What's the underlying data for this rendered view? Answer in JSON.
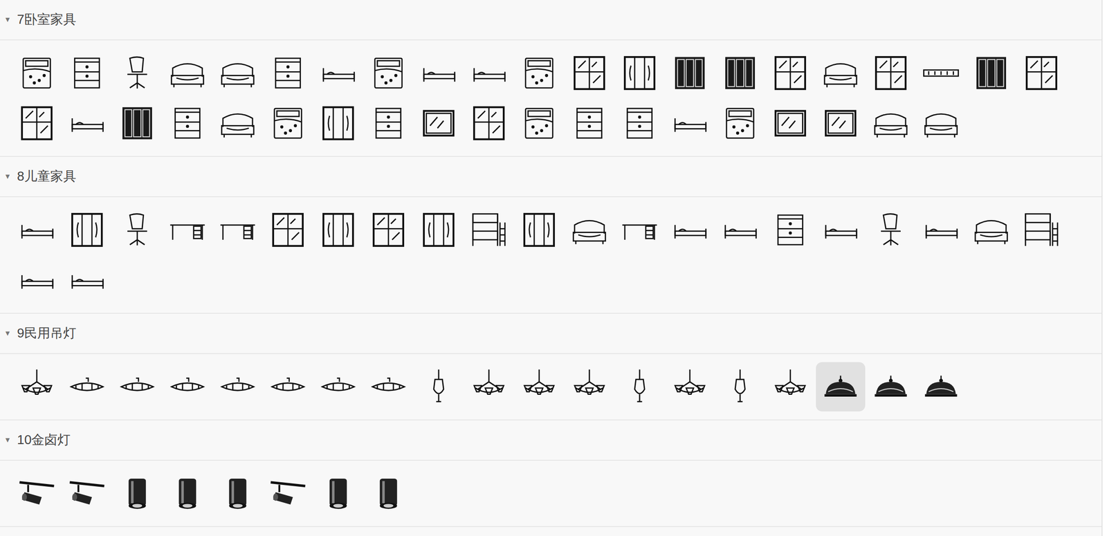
{
  "sections": [
    {
      "title": "7卧室家具",
      "toggle": "▼",
      "expanded": true,
      "items": [
        {
          "kind": "bed-plan",
          "selected": false
        },
        {
          "kind": "cabinet",
          "selected": false
        },
        {
          "kind": "chair",
          "selected": false
        },
        {
          "kind": "bed-front",
          "selected": false
        },
        {
          "kind": "bed-front",
          "selected": false
        },
        {
          "kind": "cabinet",
          "selected": false
        },
        {
          "kind": "bed-side",
          "selected": false
        },
        {
          "kind": "bed-plan",
          "selected": false
        },
        {
          "kind": "bed-side",
          "selected": false
        },
        {
          "kind": "bed-side",
          "selected": false
        },
        {
          "kind": "bed-plan",
          "selected": false
        },
        {
          "kind": "wardrobe-glass",
          "selected": false
        },
        {
          "kind": "wardrobe",
          "selected": false
        },
        {
          "kind": "wardrobe-dark",
          "selected": false
        },
        {
          "kind": "wardrobe-dark",
          "selected": false
        },
        {
          "kind": "wardrobe-glass",
          "selected": false
        },
        {
          "kind": "bed-front",
          "selected": false
        },
        {
          "kind": "wardrobe-glass",
          "selected": false
        },
        {
          "kind": "shelf",
          "selected": false
        },
        {
          "kind": "wardrobe-dark",
          "selected": false
        },
        {
          "kind": "wardrobe-glass",
          "selected": false
        },
        {
          "kind": "wardrobe-glass",
          "selected": false
        },
        {
          "kind": "bed-side",
          "selected": false
        },
        {
          "kind": "wardrobe-dark",
          "selected": false
        },
        {
          "kind": "cabinet",
          "selected": false
        },
        {
          "kind": "bed-front",
          "selected": false
        },
        {
          "kind": "bed-plan",
          "selected": false
        },
        {
          "kind": "wardrobe",
          "selected": false
        },
        {
          "kind": "cabinet",
          "selected": false
        },
        {
          "kind": "mirror",
          "selected": false
        },
        {
          "kind": "wardrobe-glass",
          "selected": false
        },
        {
          "kind": "bed-plan",
          "selected": false
        },
        {
          "kind": "cabinet",
          "selected": false
        },
        {
          "kind": "cabinet",
          "selected": false
        },
        {
          "kind": "bed-side",
          "selected": false
        },
        {
          "kind": "bed-plan",
          "selected": false
        },
        {
          "kind": "mirror",
          "selected": false
        },
        {
          "kind": "mirror",
          "selected": false
        },
        {
          "kind": "bed-front",
          "selected": false
        },
        {
          "kind": "bed-front",
          "selected": false
        }
      ]
    },
    {
      "title": "8儿童家具",
      "toggle": "▼",
      "expanded": true,
      "items": [
        {
          "kind": "bed-side",
          "selected": false
        },
        {
          "kind": "wardrobe",
          "selected": false
        },
        {
          "kind": "chair",
          "selected": false
        },
        {
          "kind": "desk",
          "selected": false
        },
        {
          "kind": "desk",
          "selected": false
        },
        {
          "kind": "wardrobe-glass",
          "selected": false
        },
        {
          "kind": "wardrobe",
          "selected": false
        },
        {
          "kind": "wardrobe-glass",
          "selected": false
        },
        {
          "kind": "wardrobe",
          "selected": false
        },
        {
          "kind": "bunk",
          "selected": false
        },
        {
          "kind": "wardrobe",
          "selected": false
        },
        {
          "kind": "bed-front",
          "selected": false
        },
        {
          "kind": "desk",
          "selected": false
        },
        {
          "kind": "bed-side",
          "selected": false
        },
        {
          "kind": "bed-side",
          "selected": false
        },
        {
          "kind": "cabinet",
          "selected": false
        },
        {
          "kind": "bed-side",
          "selected": false
        },
        {
          "kind": "chair",
          "selected": false
        },
        {
          "kind": "bed-side",
          "selected": false
        },
        {
          "kind": "bed-front",
          "selected": false
        },
        {
          "kind": "bunk",
          "selected": false
        },
        {
          "kind": "bed-side",
          "selected": false
        },
        {
          "kind": "bed-side",
          "selected": false
        }
      ]
    },
    {
      "title": "9民用吊灯",
      "toggle": "▼",
      "expanded": true,
      "items": [
        {
          "kind": "chandelier",
          "selected": false
        },
        {
          "kind": "ceiling-lamp",
          "selected": false
        },
        {
          "kind": "ceiling-lamp",
          "selected": false
        },
        {
          "kind": "ceiling-lamp",
          "selected": false
        },
        {
          "kind": "ceiling-lamp",
          "selected": false
        },
        {
          "kind": "ceiling-lamp",
          "selected": false
        },
        {
          "kind": "ceiling-lamp",
          "selected": false
        },
        {
          "kind": "ceiling-lamp",
          "selected": false
        },
        {
          "kind": "pendant",
          "selected": false
        },
        {
          "kind": "chandelier",
          "selected": false
        },
        {
          "kind": "chandelier",
          "selected": false
        },
        {
          "kind": "chandelier",
          "selected": false
        },
        {
          "kind": "pendant",
          "selected": false
        },
        {
          "kind": "chandelier",
          "selected": false
        },
        {
          "kind": "pendant",
          "selected": false
        },
        {
          "kind": "chandelier",
          "selected": false
        },
        {
          "kind": "dome-lamp",
          "selected": true
        },
        {
          "kind": "dome-lamp",
          "selected": false
        },
        {
          "kind": "dome-lamp",
          "selected": false
        }
      ]
    },
    {
      "title": "10金卤灯",
      "toggle": "▼",
      "expanded": true,
      "items": [
        {
          "kind": "track-light",
          "selected": false
        },
        {
          "kind": "track-light",
          "selected": false
        },
        {
          "kind": "can-light",
          "selected": false
        },
        {
          "kind": "can-light",
          "selected": false
        },
        {
          "kind": "can-light",
          "selected": false
        },
        {
          "kind": "track-light",
          "selected": false
        },
        {
          "kind": "can-light",
          "selected": false
        },
        {
          "kind": "can-light",
          "selected": false
        }
      ]
    }
  ]
}
